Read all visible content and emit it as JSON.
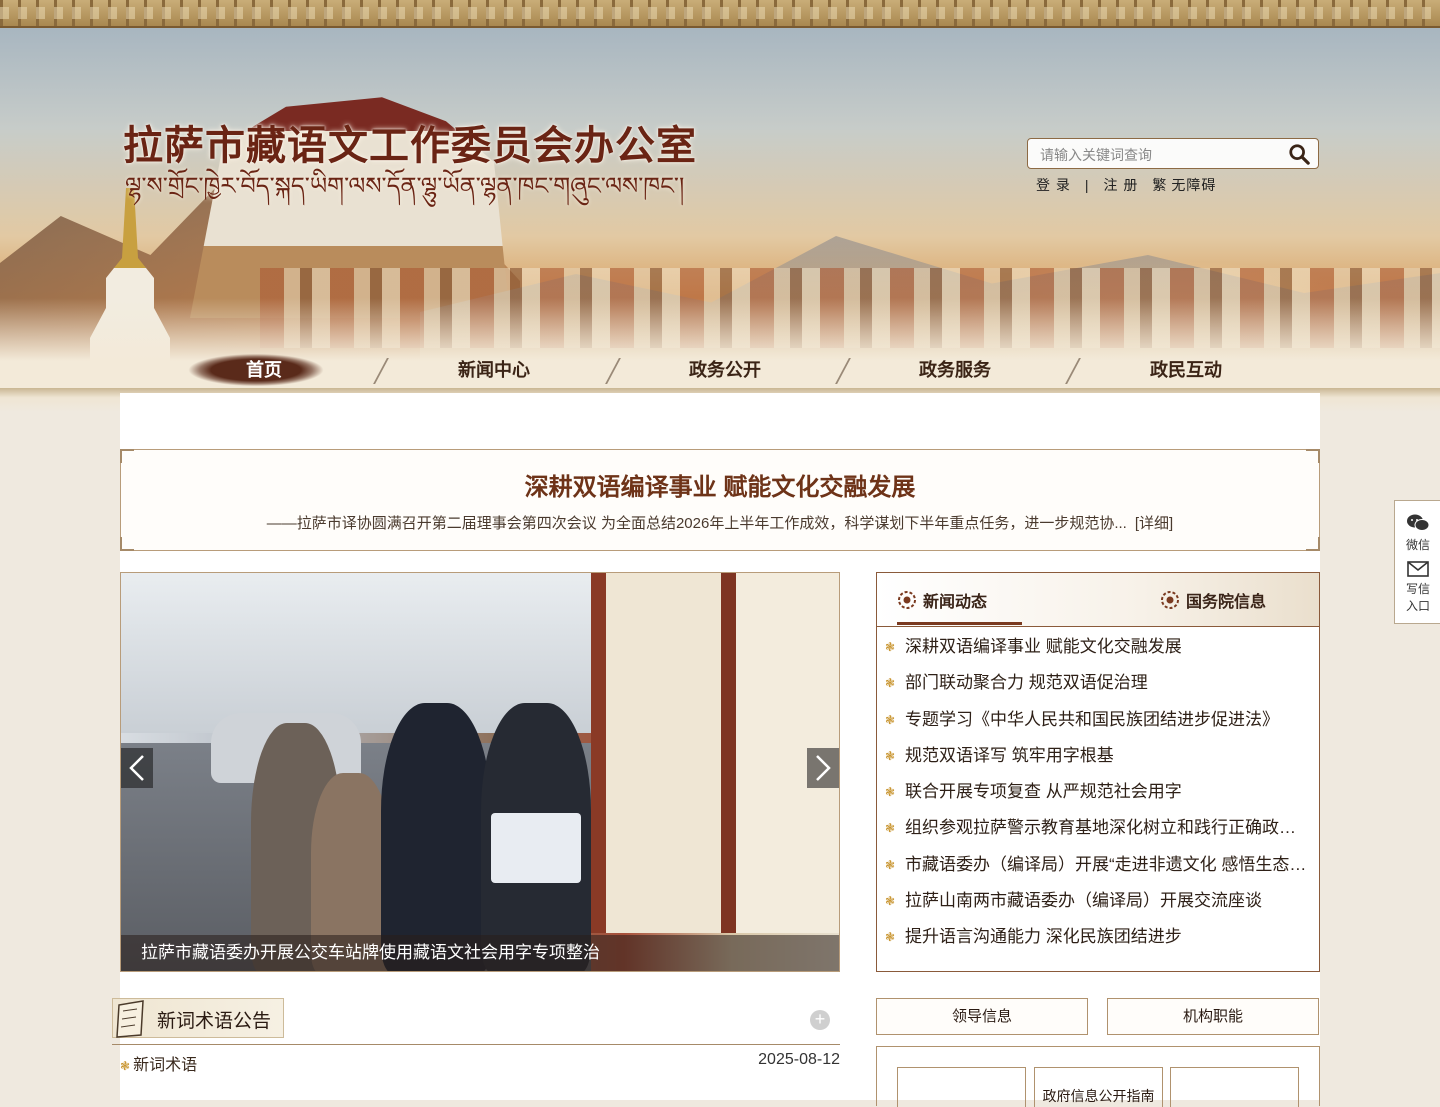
{
  "site": {
    "title": "拉萨市藏语文工作委员会办公室",
    "subtitle_tibetan": "ལྷ་ས་གྲོང་ཁྱེར་བོད་སྐད་ཡིག་ལས་དོན་ལྷུ་ཡོན་ལྷན་ཁང་གཞུང་ལས་ཁང་།"
  },
  "search": {
    "placeholder": "请输入关键词查询",
    "icon": "search-icon"
  },
  "user_links": {
    "login": "登 录",
    "separator": "|",
    "register": "注 册",
    "traditional": "繁",
    "accessibility": "无障碍"
  },
  "nav": {
    "items": [
      "首页",
      "新闻中心",
      "政务公开",
      "政务服务",
      "政民互动"
    ],
    "active": "首页"
  },
  "headline": {
    "title": "深耕双语编译事业 赋能文化交融发展",
    "description": "——拉萨市译协圆满召开第二届理事会第四次会议 为全面总结2026年上半年工作成效，科学谋划下半年重点任务，进一步规范协...",
    "more": "[详细]"
  },
  "carousel": {
    "caption": "拉萨市藏语委办开展公交车站牌使用藏语文社会用字专项整治"
  },
  "news_panel": {
    "tabs": [
      "新闻动态",
      "国务院信息"
    ],
    "active_tab": "新闻动态",
    "items": [
      "深耕双语编译事业 赋能文化交融发展",
      "部门联动聚合力 规范双语促治理",
      "专题学习《中华人民共和国民族团结进步促进法》",
      "规范双语译写 筑牢用字根基",
      "联合开展专项复查 从严规范社会用字",
      "组织参观拉萨警示教育基地深化树立和践行正确政绩观",
      "市藏语委办（编译局）开展“走进非遗文化 感悟生态之美”",
      "拉萨山南两市藏语委办（编译局）开展交流座谈",
      "提升语言沟通能力 深化民族团结进步"
    ]
  },
  "terms": {
    "title": "新词术语公告",
    "more_symbol": "+",
    "rows": [
      {
        "label": "新词术语",
        "date": "2025-08-12"
      }
    ]
  },
  "info_buttons": [
    "领导信息",
    "机构职能"
  ],
  "sub_cards": [
    "",
    "政府信息公开指南",
    ""
  ],
  "side_float": {
    "wechat": "微信",
    "write_line1": "写信",
    "write_line2": "入口"
  },
  "colors": {
    "brand": "#6a2414",
    "accent": "#7a3a20",
    "bullet": "#c8942e",
    "border": "#b89c7a"
  }
}
